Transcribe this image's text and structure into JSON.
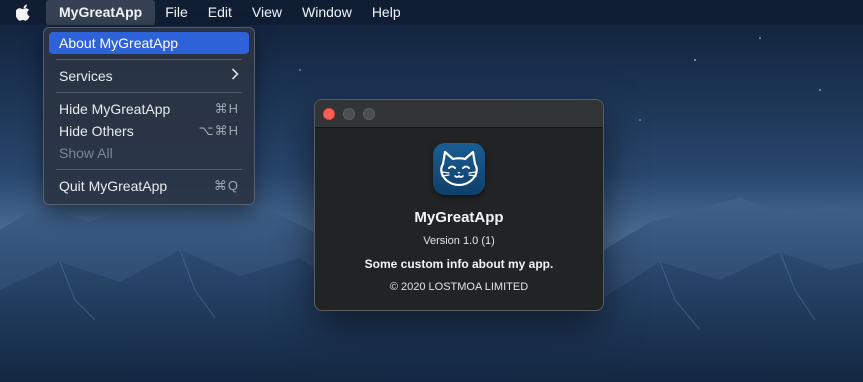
{
  "menubar": {
    "apple_icon": "apple-logo-icon",
    "app_menu": "MyGreatApp",
    "items": [
      "File",
      "Edit",
      "View",
      "Window",
      "Help"
    ]
  },
  "app_menu": {
    "about": "About MyGreatApp",
    "services": "Services",
    "hide": "Hide MyGreatApp",
    "hide_shortcut": "⌘H",
    "hide_others": "Hide Others",
    "hide_others_shortcut": "⌥⌘H",
    "show_all": "Show All",
    "quit": "Quit MyGreatApp",
    "quit_shortcut": "⌘Q"
  },
  "about_window": {
    "icon": "cat-face-icon",
    "app_name": "MyGreatApp",
    "version": "Version 1.0 (1)",
    "custom_info": "Some custom info about my app.",
    "copyright": "© 2020 LOSTMOA LIMITED"
  },
  "colors": {
    "highlight": "#2e62d9",
    "close_button": "#ff5f57",
    "icon_blue": "#1a5d93"
  }
}
